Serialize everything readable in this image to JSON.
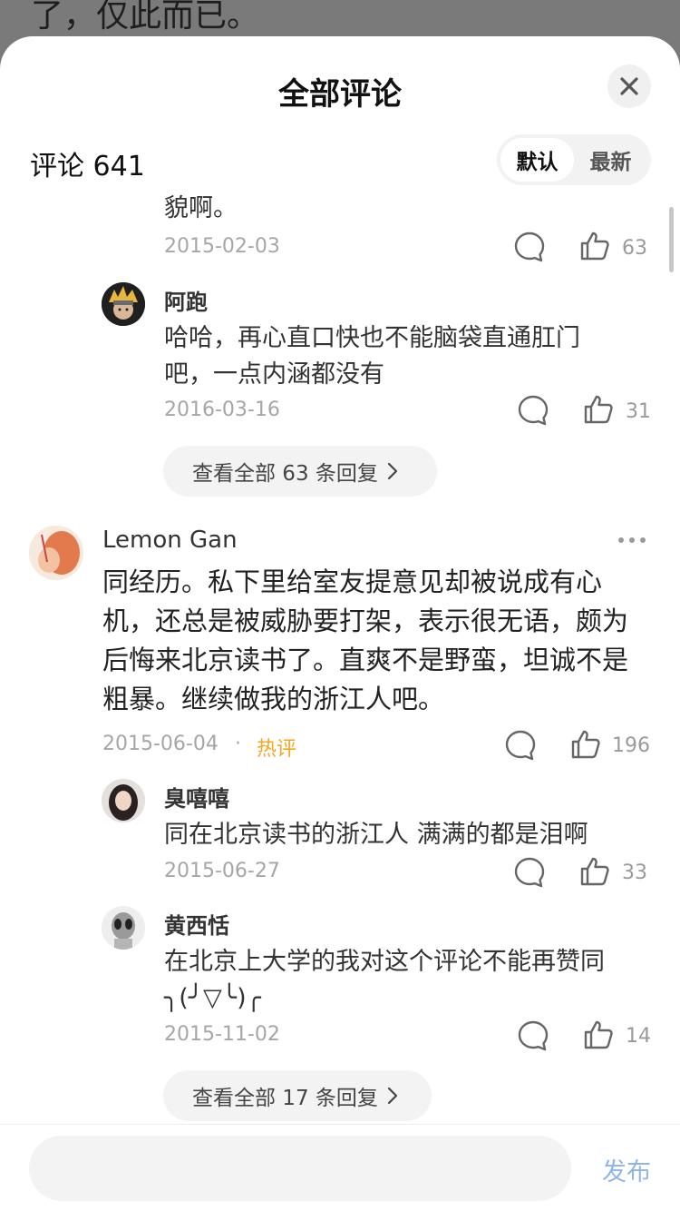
{
  "background": {
    "text": "了，仅此而已。"
  },
  "header": {
    "title": "全部评论",
    "close_icon": "close-icon"
  },
  "toolbar": {
    "count_label": "评论 641",
    "sort_default": "默认",
    "sort_latest": "最新"
  },
  "comments": [
    {
      "text": "貌啊。",
      "date": "2015-02-03",
      "likes": "63"
    },
    {
      "name": "阿跑",
      "text": "哈哈，再心直口快也不能脑袋直通肛门吧，一点内涵都没有",
      "date": "2016-03-16",
      "likes": "31"
    },
    {
      "view_all": "查看全部 63 条回复"
    },
    {
      "name": "Lemon Gan",
      "text": "同经历。私下里给室友提意见却被说成有心机，还总是被威胁要打架，表示很无语，颇为后悔来北京读书了。直爽不是野蛮，坦诚不是粗暴。继续做我的浙江人吧。",
      "date": "2015-06-04",
      "hot": "热评",
      "likes": "196"
    },
    {
      "name": "臭嘻嘻",
      "text": "同在北京读书的浙江人 满满的都是泪啊",
      "date": "2015-06-27",
      "likes": "33"
    },
    {
      "name": "黄西恬",
      "text": "在北京上大学的我对这个评论不能再赞同 ╮(╯▽╰)╭",
      "date": "2015-11-02",
      "likes": "14"
    },
    {
      "view_all": "查看全部 17 条回复"
    }
  ],
  "bottom": {
    "input_placeholder": "",
    "send_label": "发布"
  },
  "colors": {
    "accent_hot": "#f5a623",
    "send": "#8fb5e6"
  }
}
